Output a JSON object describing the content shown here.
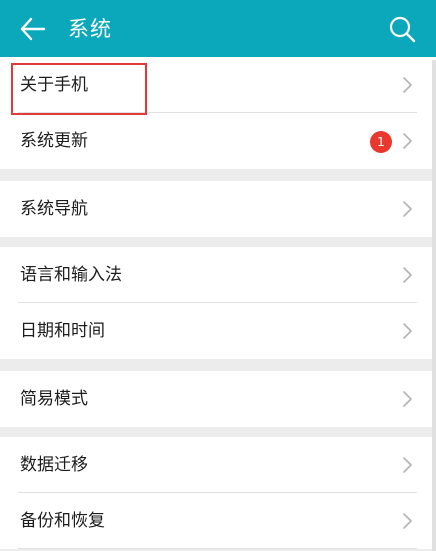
{
  "header": {
    "title": "系统",
    "background_color": "#0ba7bb",
    "back_icon": "arrow-left-icon",
    "search_icon": "search-icon"
  },
  "groups": [
    {
      "items": [
        {
          "label": "关于手机"
        },
        {
          "label": "系统更新",
          "badge": "1"
        }
      ]
    },
    {
      "items": [
        {
          "label": "系统导航"
        }
      ]
    },
    {
      "items": [
        {
          "label": "语言和输入法"
        },
        {
          "label": "日期和时间"
        }
      ]
    },
    {
      "items": [
        {
          "label": "简易模式"
        }
      ]
    },
    {
      "items": [
        {
          "label": "数据迁移"
        },
        {
          "label": "备份和恢复"
        }
      ]
    }
  ],
  "colors": {
    "badge": "#e8372d",
    "highlight": "#e23a3a"
  }
}
